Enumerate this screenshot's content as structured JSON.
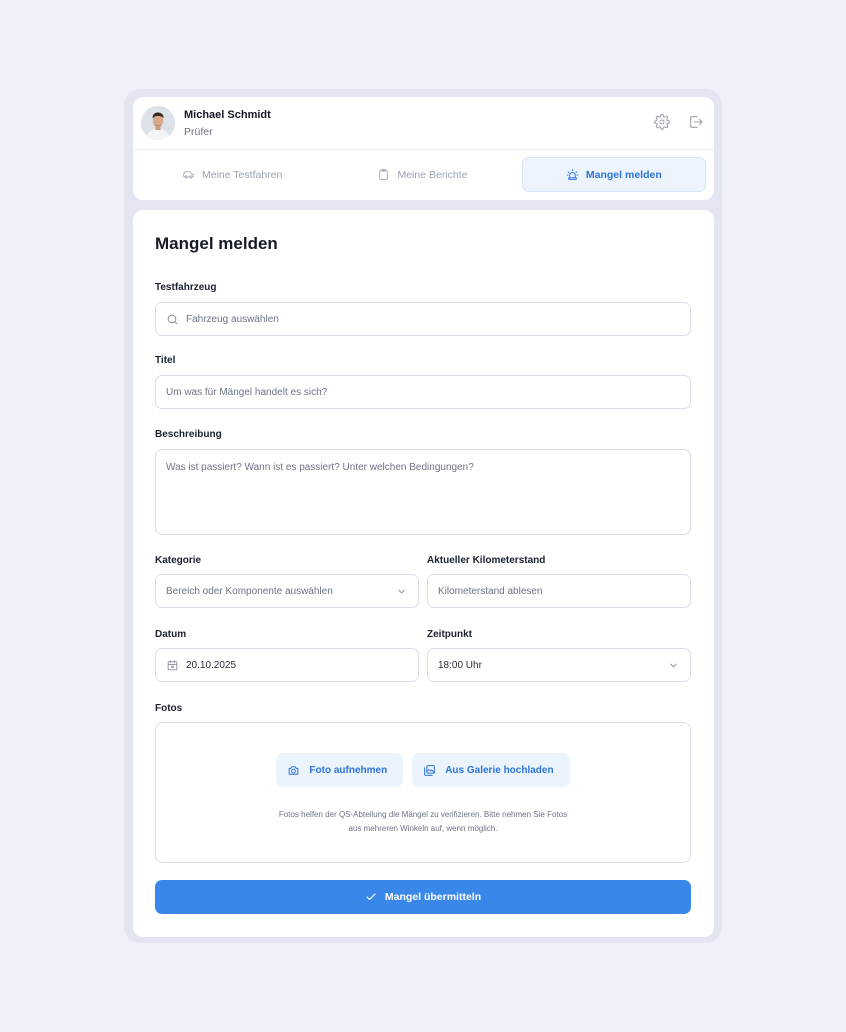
{
  "user": {
    "name": "Michael Schmidt",
    "role": "Prüfer"
  },
  "header_icons": [
    "gear-icon",
    "logout-icon"
  ],
  "tabs": [
    {
      "label": "Meine Testfahren",
      "icon": "car-icon",
      "active": false
    },
    {
      "label": "Meine Berichte",
      "icon": "clipboard-icon",
      "active": false
    },
    {
      "label": "Mangel melden",
      "icon": "siren-icon",
      "active": true
    }
  ],
  "form": {
    "title": "Mangel melden",
    "vehicle": {
      "label": "Testfahrzeug",
      "placeholder": "Fahrzeug auswählen"
    },
    "title_field": {
      "label": "Titel",
      "placeholder": "Um was für Mängel handelt es sich?"
    },
    "description": {
      "label": "Beschreibung",
      "placeholder": "Was ist passiert? Wann ist es passiert? Unter welchen Bedingungen?"
    },
    "category": {
      "label": "Kategorie",
      "placeholder": "Bereich oder Komponente auswählen"
    },
    "mileage": {
      "label": "Aktueller Kilometerstand",
      "placeholder": "Kilometerstand ablesen"
    },
    "date": {
      "label": "Datum",
      "value": "20.10.2025"
    },
    "time": {
      "label": "Zeitpunkt",
      "value": "18:00 Uhr"
    },
    "photos": {
      "label": "Fotos",
      "take_photo": "Foto aufnehmen",
      "upload_gallery": "Aus Galerie hochladen",
      "hint_line1": "Fotos helfen der QS-Abteilung die Mängel zu verifizieren. Bitte nehmen Sie Fotos",
      "hint_line2": "aus mehreren Winkeln auf, wenn möglich."
    },
    "submit": "Mangel übermitteln"
  },
  "colors": {
    "accent": "#3a87ea",
    "accent_text": "#2c74d8",
    "background": "#eff0f8"
  }
}
